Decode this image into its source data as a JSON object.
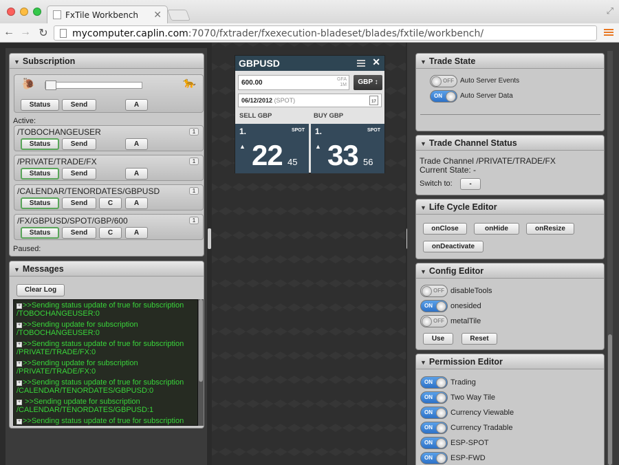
{
  "browser": {
    "tab_title": "FxTile Workbench",
    "url_host": "mycomputer.caplin.com",
    "url_rest": ":7070/fxtrader/fxexecution-bladeset/blades/fxtile/workbench/"
  },
  "subscription": {
    "title": "Subscription",
    "status": "Status",
    "send": "Send",
    "a": "A",
    "c": "C",
    "active_label": "Active:",
    "paused_label": "Paused:",
    "rows": [
      {
        "path": "/TOBOCHANGEUSER",
        "count": "1"
      },
      {
        "path": "/PRIVATE/TRADE/FX",
        "count": "1"
      },
      {
        "path": "/CALENDAR/TENORDATES/GBPUSD",
        "count": "1"
      },
      {
        "path": "/FX/GBPUSD/SPOT/GBP/600",
        "count": "1"
      }
    ]
  },
  "messages": {
    "title": "Messages",
    "clear": "Clear Log",
    "entries": [
      {
        "l1": ">>Sending status update of true for subscription",
        "l2": "/TOBOCHANGEUSER:0"
      },
      {
        "l1": ">>Sending update for subscription",
        "l2": "/TOBOCHANGEUSER:0"
      },
      {
        "l1": ">>Sending status update of true for subscription",
        "l2": "/PRIVATE/TRADE/FX:0"
      },
      {
        "l1": ">>Sending update for subscription",
        "l2": "/PRIVATE/TRADE/FX:0"
      },
      {
        "l1": ">>Sending status update of true for subscription",
        "l2": "/CALENDAR/TENORDATES/GBPUSD:0"
      },
      {
        "l1": " >>Sending update for subscription",
        "l2": " /CALENDAR/TENORDATES/GBPUSD:1"
      },
      {
        "l1": ">>Sending status update of true for subscription",
        "l2": ""
      }
    ]
  },
  "tile": {
    "pair": "GBPUSD",
    "amount": "600.00",
    "gfa1": "GFA",
    "gfa2": "1M",
    "ccy": "GBP ↕",
    "date": "06/12/2012",
    "date_tag": "(SPOT)",
    "cal": "17",
    "sell": "SELL GBP",
    "buy": "BUY GBP",
    "sell_tenor": "1.",
    "buy_tenor": "1.",
    "spot": "SPOT",
    "arrow": "▲",
    "sell_big": "22",
    "sell_pip": "45",
    "buy_big": "33",
    "buy_pip": "56"
  },
  "trade_state": {
    "title": "Trade State",
    "on": "ON",
    "off": "OFF",
    "t1": "Auto Server Events",
    "t2": "Auto Server Data"
  },
  "channel": {
    "title": "Trade Channel Status",
    "line1": "Trade Channel /PRIVATE/TRADE/FX",
    "line2": "Current State: -",
    "switch": "Switch to:",
    "btn": "-"
  },
  "lifecycle": {
    "title": "Life Cycle Editor",
    "b1": "onClose",
    "b2": "onHide",
    "b3": "onResize",
    "b4": "onDeactivate"
  },
  "config": {
    "title": "Config Editor",
    "t1": "disableTools",
    "t2": "onesided",
    "t3": "metalTile",
    "use": "Use",
    "reset": "Reset"
  },
  "permission": {
    "title": "Permission Editor",
    "items": [
      "Trading",
      "Two Way Tile",
      "Currency Viewable",
      "Currency Tradable",
      "ESP-SPOT",
      "ESP-FWD"
    ]
  }
}
